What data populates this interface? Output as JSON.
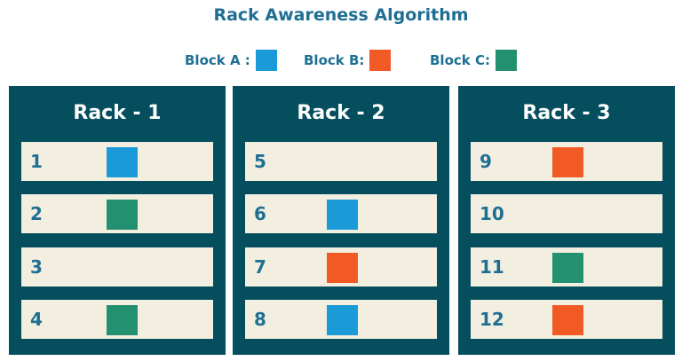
{
  "title": "Rack Awareness Algorithm",
  "legend": [
    {
      "label": "Block A :",
      "color": "#1a9ad6"
    },
    {
      "label": "Block B:",
      "color": "#f15a24"
    },
    {
      "label": "Block C:",
      "color": "#23906f"
    }
  ],
  "racks": [
    {
      "title": "Rack - 1",
      "slots": [
        {
          "num": "1",
          "block": "A"
        },
        {
          "num": "2",
          "block": "C"
        },
        {
          "num": "3",
          "block": null
        },
        {
          "num": "4",
          "block": "C"
        }
      ]
    },
    {
      "title": "Rack - 2",
      "slots": [
        {
          "num": "5",
          "block": null
        },
        {
          "num": "6",
          "block": "A"
        },
        {
          "num": "7",
          "block": "B"
        },
        {
          "num": "8",
          "block": "A"
        }
      ]
    },
    {
      "title": "Rack - 3",
      "slots": [
        {
          "num": "9",
          "block": "B"
        },
        {
          "num": "10",
          "block": null
        },
        {
          "num": "11",
          "block": "C"
        },
        {
          "num": "12",
          "block": "B"
        }
      ]
    }
  ]
}
